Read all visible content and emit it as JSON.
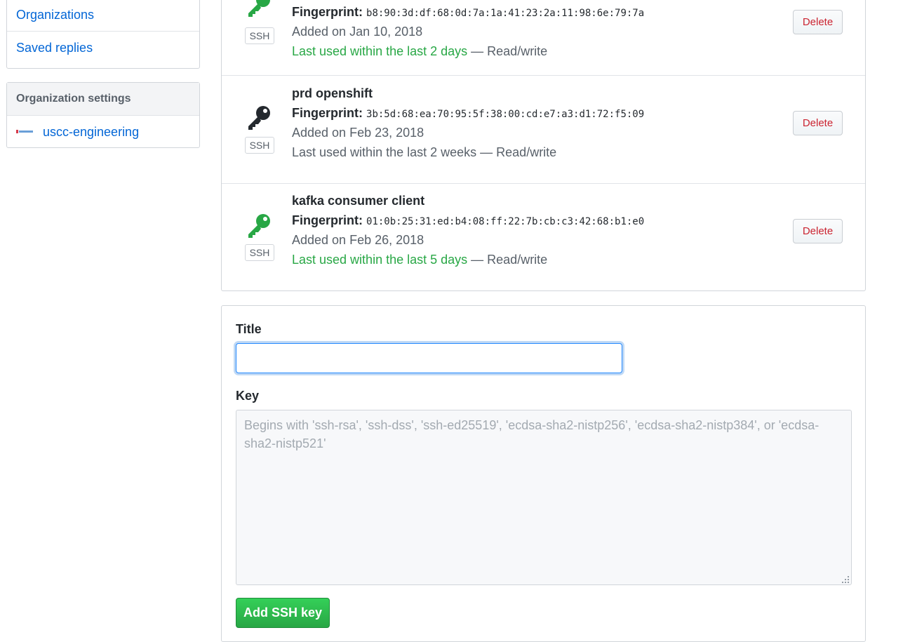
{
  "sidebar": {
    "menu_items": [
      {
        "label": "Organizations"
      },
      {
        "label": "Saved replies"
      }
    ],
    "org_settings": {
      "heading": "Organization settings",
      "org_name": "uscc-engineering"
    }
  },
  "keys": [
    {
      "title": "",
      "fingerprint_label": "Fingerprint:",
      "fingerprint": "b8:90:3d:df:68:0d:7a:1a:41:23:2a:11:98:6e:79:7a",
      "added": "Added on Jan 10, 2018",
      "last_used": "Last used within the last 2 days",
      "access": " — Read/write",
      "recent": true,
      "badge": "SSH",
      "delete_label": "Delete",
      "icon": "key-icon",
      "icon_color": "#28a745"
    },
    {
      "title": "prd openshift",
      "fingerprint_label": "Fingerprint:",
      "fingerprint": "3b:5d:68:ea:70:95:5f:38:00:cd:e7:a3:d1:72:f5:09",
      "added": "Added on Feb 23, 2018",
      "last_used": "Last used within the last 2 weeks",
      "access": " — Read/write",
      "recent": false,
      "badge": "SSH",
      "delete_label": "Delete",
      "icon": "key-icon",
      "icon_color": "#24292e"
    },
    {
      "title": "kafka consumer client",
      "fingerprint_label": "Fingerprint:",
      "fingerprint": "01:0b:25:31:ed:b4:08:ff:22:7b:cb:c3:42:68:b1:e0",
      "added": "Added on Feb 26, 2018",
      "last_used": "Last used within the last 5 days",
      "access": " — Read/write",
      "recent": true,
      "badge": "SSH",
      "delete_label": "Delete",
      "icon": "key-icon",
      "icon_color": "#28a745"
    }
  ],
  "form": {
    "title_label": "Title",
    "title_value": "",
    "key_label": "Key",
    "key_placeholder": "Begins with 'ssh-rsa', 'ssh-dss', 'ssh-ed25519', 'ecdsa-sha2-nistp256', 'ecdsa-sha2-nistp384', or 'ecdsa-sha2-nistp521'",
    "submit_label": "Add SSH key"
  },
  "colors": {
    "link": "#0366d6",
    "recent_green": "#28a745",
    "danger": "#cb2431",
    "primary_button": "#28a745"
  }
}
